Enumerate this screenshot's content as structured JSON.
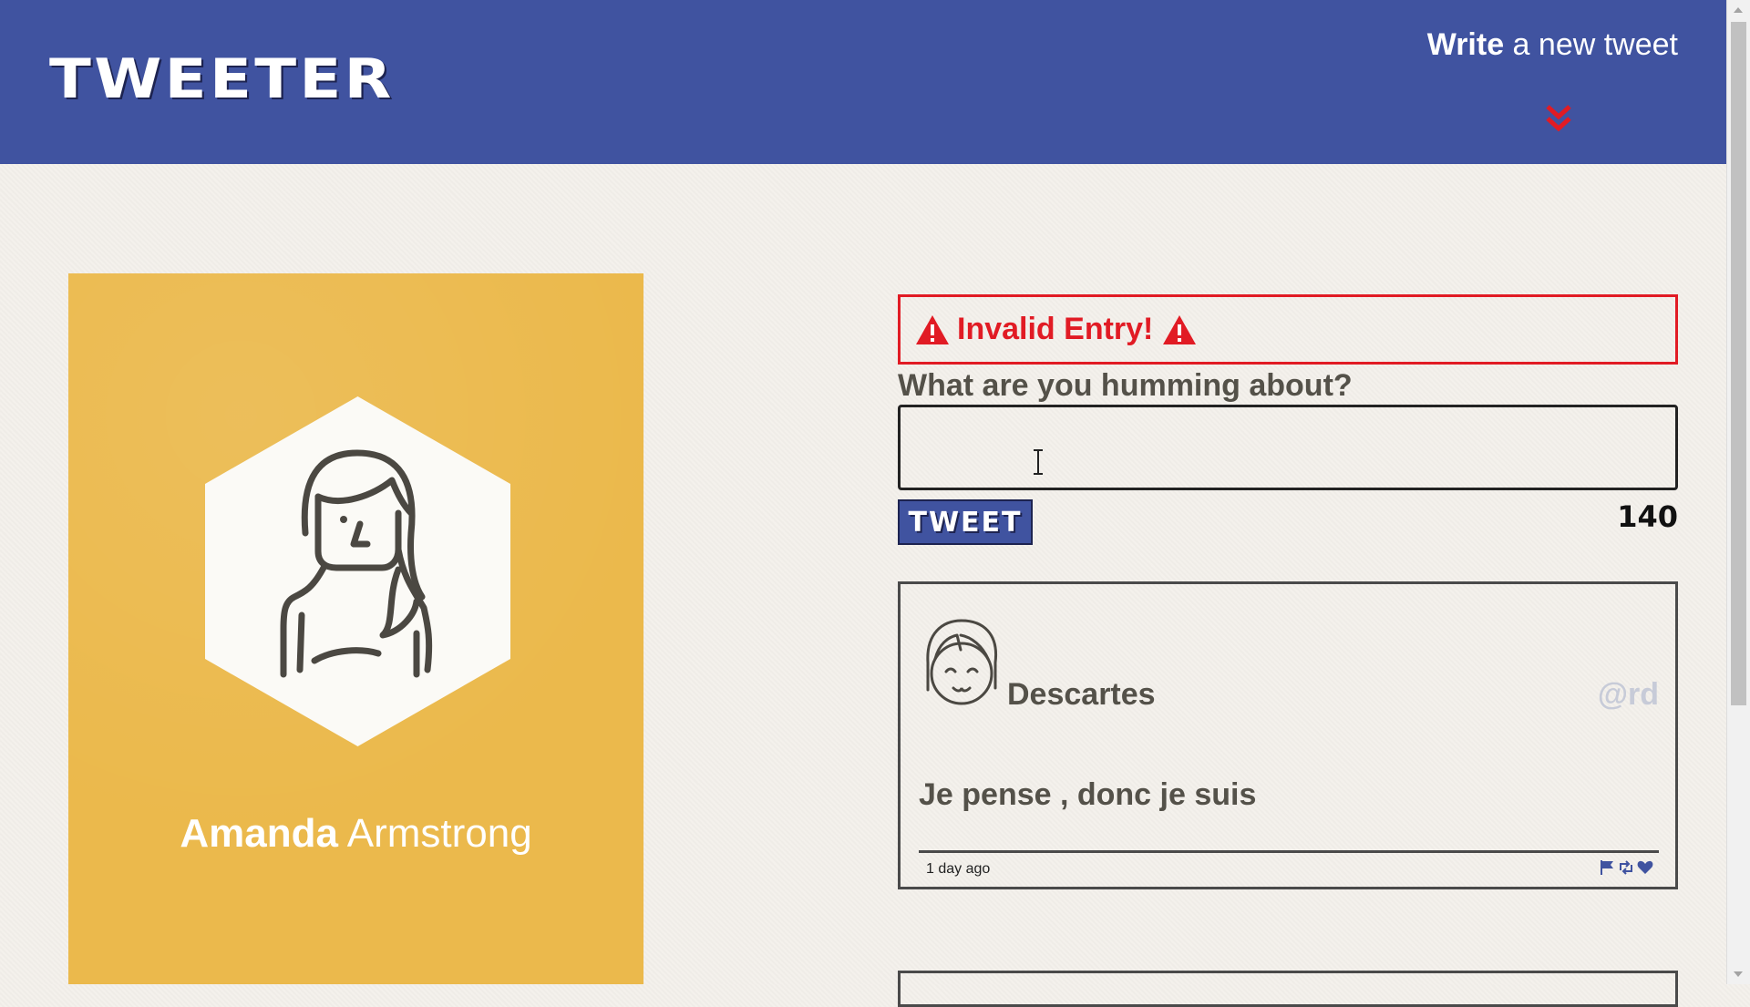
{
  "nav": {
    "logo": "TWEETER",
    "compose_bold": "Write",
    "compose_rest": " a new tweet",
    "chevron_icon": "double-chevron-down-icon",
    "accent_color": "#e11b24",
    "background_color": "#4053a0"
  },
  "profile": {
    "first_name": "Amanda",
    "last_name": "Armstrong",
    "avatar_icon": "woman-avatar-icon",
    "card_color": "#ebb94c"
  },
  "composer": {
    "error_message": "Invalid Entry!",
    "warning_icon": "warning-triangle-icon",
    "prompt": "What are you humming about?",
    "input_value": "",
    "button_label": "TWEET",
    "char_count": "140"
  },
  "tweets": [
    {
      "name": "Descartes",
      "handle": "@rd",
      "body": "Je pense , donc je suis",
      "timestamp": "1 day ago",
      "avatar_icon": "girl-face-avatar-icon",
      "actions": [
        "flag-icon",
        "retweet-icon",
        "heart-icon"
      ]
    }
  ]
}
